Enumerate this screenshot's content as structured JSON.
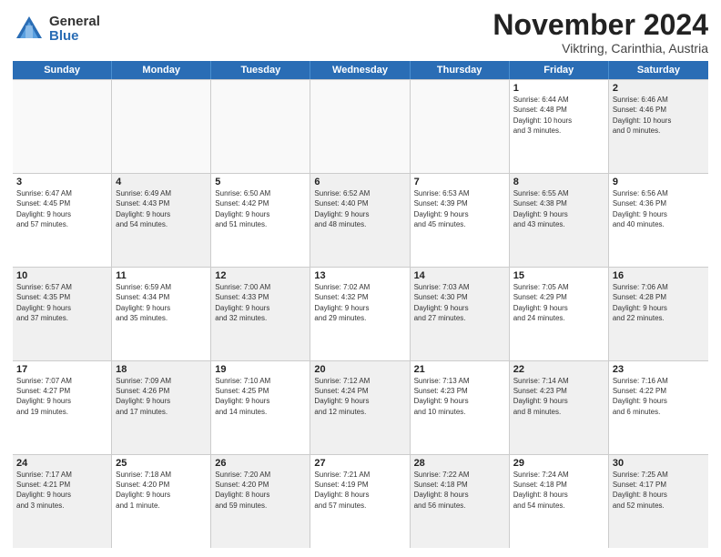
{
  "logo": {
    "general": "General",
    "blue": "Blue"
  },
  "title": "November 2024",
  "subtitle": "Viktring, Carinthia, Austria",
  "days_of_week": [
    "Sunday",
    "Monday",
    "Tuesday",
    "Wednesday",
    "Thursday",
    "Friday",
    "Saturday"
  ],
  "weeks": [
    [
      {
        "day": "",
        "info": "",
        "empty": true
      },
      {
        "day": "",
        "info": "",
        "empty": true
      },
      {
        "day": "",
        "info": "",
        "empty": true
      },
      {
        "day": "",
        "info": "",
        "empty": true
      },
      {
        "day": "",
        "info": "",
        "empty": true
      },
      {
        "day": "1",
        "info": "Sunrise: 6:44 AM\nSunset: 4:48 PM\nDaylight: 10 hours\nand 3 minutes.",
        "empty": false
      },
      {
        "day": "2",
        "info": "Sunrise: 6:46 AM\nSunset: 4:46 PM\nDaylight: 10 hours\nand 0 minutes.",
        "empty": false,
        "shaded": true
      }
    ],
    [
      {
        "day": "3",
        "info": "Sunrise: 6:47 AM\nSunset: 4:45 PM\nDaylight: 9 hours\nand 57 minutes.",
        "empty": false
      },
      {
        "day": "4",
        "info": "Sunrise: 6:49 AM\nSunset: 4:43 PM\nDaylight: 9 hours\nand 54 minutes.",
        "empty": false,
        "shaded": true
      },
      {
        "day": "5",
        "info": "Sunrise: 6:50 AM\nSunset: 4:42 PM\nDaylight: 9 hours\nand 51 minutes.",
        "empty": false
      },
      {
        "day": "6",
        "info": "Sunrise: 6:52 AM\nSunset: 4:40 PM\nDaylight: 9 hours\nand 48 minutes.",
        "empty": false,
        "shaded": true
      },
      {
        "day": "7",
        "info": "Sunrise: 6:53 AM\nSunset: 4:39 PM\nDaylight: 9 hours\nand 45 minutes.",
        "empty": false
      },
      {
        "day": "8",
        "info": "Sunrise: 6:55 AM\nSunset: 4:38 PM\nDaylight: 9 hours\nand 43 minutes.",
        "empty": false,
        "shaded": true
      },
      {
        "day": "9",
        "info": "Sunrise: 6:56 AM\nSunset: 4:36 PM\nDaylight: 9 hours\nand 40 minutes.",
        "empty": false
      }
    ],
    [
      {
        "day": "10",
        "info": "Sunrise: 6:57 AM\nSunset: 4:35 PM\nDaylight: 9 hours\nand 37 minutes.",
        "empty": false,
        "shaded": true
      },
      {
        "day": "11",
        "info": "Sunrise: 6:59 AM\nSunset: 4:34 PM\nDaylight: 9 hours\nand 35 minutes.",
        "empty": false
      },
      {
        "day": "12",
        "info": "Sunrise: 7:00 AM\nSunset: 4:33 PM\nDaylight: 9 hours\nand 32 minutes.",
        "empty": false,
        "shaded": true
      },
      {
        "day": "13",
        "info": "Sunrise: 7:02 AM\nSunset: 4:32 PM\nDaylight: 9 hours\nand 29 minutes.",
        "empty": false
      },
      {
        "day": "14",
        "info": "Sunrise: 7:03 AM\nSunset: 4:30 PM\nDaylight: 9 hours\nand 27 minutes.",
        "empty": false,
        "shaded": true
      },
      {
        "day": "15",
        "info": "Sunrise: 7:05 AM\nSunset: 4:29 PM\nDaylight: 9 hours\nand 24 minutes.",
        "empty": false
      },
      {
        "day": "16",
        "info": "Sunrise: 7:06 AM\nSunset: 4:28 PM\nDaylight: 9 hours\nand 22 minutes.",
        "empty": false,
        "shaded": true
      }
    ],
    [
      {
        "day": "17",
        "info": "Sunrise: 7:07 AM\nSunset: 4:27 PM\nDaylight: 9 hours\nand 19 minutes.",
        "empty": false
      },
      {
        "day": "18",
        "info": "Sunrise: 7:09 AM\nSunset: 4:26 PM\nDaylight: 9 hours\nand 17 minutes.",
        "empty": false,
        "shaded": true
      },
      {
        "day": "19",
        "info": "Sunrise: 7:10 AM\nSunset: 4:25 PM\nDaylight: 9 hours\nand 14 minutes.",
        "empty": false
      },
      {
        "day": "20",
        "info": "Sunrise: 7:12 AM\nSunset: 4:24 PM\nDaylight: 9 hours\nand 12 minutes.",
        "empty": false,
        "shaded": true
      },
      {
        "day": "21",
        "info": "Sunrise: 7:13 AM\nSunset: 4:23 PM\nDaylight: 9 hours\nand 10 minutes.",
        "empty": false
      },
      {
        "day": "22",
        "info": "Sunrise: 7:14 AM\nSunset: 4:23 PM\nDaylight: 9 hours\nand 8 minutes.",
        "empty": false,
        "shaded": true
      },
      {
        "day": "23",
        "info": "Sunrise: 7:16 AM\nSunset: 4:22 PM\nDaylight: 9 hours\nand 6 minutes.",
        "empty": false
      }
    ],
    [
      {
        "day": "24",
        "info": "Sunrise: 7:17 AM\nSunset: 4:21 PM\nDaylight: 9 hours\nand 3 minutes.",
        "empty": false,
        "shaded": true
      },
      {
        "day": "25",
        "info": "Sunrise: 7:18 AM\nSunset: 4:20 PM\nDaylight: 9 hours\nand 1 minute.",
        "empty": false
      },
      {
        "day": "26",
        "info": "Sunrise: 7:20 AM\nSunset: 4:20 PM\nDaylight: 8 hours\nand 59 minutes.",
        "empty": false,
        "shaded": true
      },
      {
        "day": "27",
        "info": "Sunrise: 7:21 AM\nSunset: 4:19 PM\nDaylight: 8 hours\nand 57 minutes.",
        "empty": false
      },
      {
        "day": "28",
        "info": "Sunrise: 7:22 AM\nSunset: 4:18 PM\nDaylight: 8 hours\nand 56 minutes.",
        "empty": false,
        "shaded": true
      },
      {
        "day": "29",
        "info": "Sunrise: 7:24 AM\nSunset: 4:18 PM\nDaylight: 8 hours\nand 54 minutes.",
        "empty": false
      },
      {
        "day": "30",
        "info": "Sunrise: 7:25 AM\nSunset: 4:17 PM\nDaylight: 8 hours\nand 52 minutes.",
        "empty": false,
        "shaded": true
      }
    ]
  ]
}
